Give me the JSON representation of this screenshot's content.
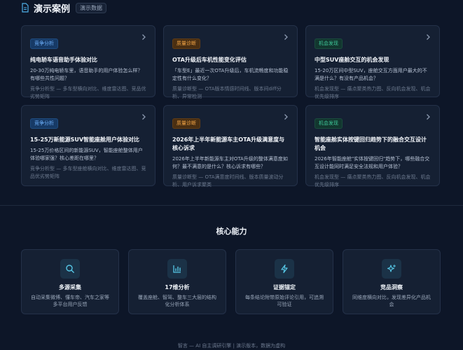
{
  "header": {
    "icon": "document-icon",
    "title": "演示案例",
    "badge": "演示数据"
  },
  "cases": [
    {
      "tag": "竞争分析",
      "tag_color": "blue",
      "title": "纯电轿车语音助手体验对比",
      "question": "20-30万纯电轿车里，语音助手的用户体验怎么样？有哪些共性问题？",
      "meta": "竞争分析型 — 多车型横向对比、维度雷达图、竞品优劣势矩阵"
    },
    {
      "tag": "质量诊断",
      "tag_color": "orange",
      "title": "OTA升级后车机性能变化评估",
      "question": "「车型E」最近一次OTA升级后，车机流畅度和功能稳定性有什么变化？",
      "meta": "质量诊断型 — OTA版本情感时间线、版本间diff分析、异常检测"
    },
    {
      "tag": "机会发现",
      "tag_color": "green",
      "title": "中型SUV座舱交互的机会发现",
      "question": "15-20万区间中型SUV，座舱交互方面用户最大的不满是什么？有没有产品机会？",
      "meta": "机会发现型 — 痛点聚类热力图、反向机会发现、机会优先级排序"
    },
    {
      "tag": "竞争分析",
      "tag_color": "blue",
      "title": "15-25万新能源SUV智能座舱用户体验对比",
      "question": "15-25万价格区间的新能源SUV，智能座舱整体用户体验哪家强？核心差距在哪里？",
      "meta": "竞争分析型 — 多车型座舱横向对比、维度雷达图、竞品优劣势矩阵"
    },
    {
      "tag": "质量诊断",
      "tag_color": "orange",
      "title": "2026年上半年新能源车主OTA升级满意度与核心诉求",
      "question": "2026年上半年新能源车主对OTA升级的整体满意度如何？最不满意的是什么？核心诉求有哪些？",
      "meta": "质量诊断型 — OTA满意度时间线、版本质量波动分析、用户诉求聚类"
    },
    {
      "tag": "机会发现",
      "tag_color": "green",
      "title": "智能座舱实体按键回归趋势下的融合交互设计机会",
      "question": "2026年智能座舱\"实体按键回归\"趋势下，哪些融合交互设计能同时满足安全法规和用户体验？",
      "meta": "机会发现型 — 痛点聚类热力图、反向机会发现、机会优先级排序"
    }
  ],
  "capabilities_title": "核心能力",
  "capabilities": [
    {
      "icon": "search-icon",
      "name": "多源采集",
      "desc": "自动采集微博、懂车帝、汽车之家等多平台用户反馈"
    },
    {
      "icon": "bar-chart-icon",
      "name": "17维分析",
      "desc": "覆盖座舱、智驾、整车三大层的结构化分析体系"
    },
    {
      "icon": "lightning-icon",
      "name": "证据锚定",
      "desc": "每条结论附带原始评论引用，可追溯可验证"
    },
    {
      "icon": "sparkles-icon",
      "name": "竞品洞察",
      "desc": "同维度横向对比，发现差异化产品机会"
    }
  ],
  "footer": "智言 — AI 自主调研引擎 | 演示版本，数据为虚构",
  "colors": {
    "background": "#0d1628",
    "card": "#152033",
    "accent_blue": "#6fb3ff",
    "accent_orange": "#f0a345",
    "accent_green": "#3fc89a",
    "icon_cyan": "#56c7e6"
  }
}
